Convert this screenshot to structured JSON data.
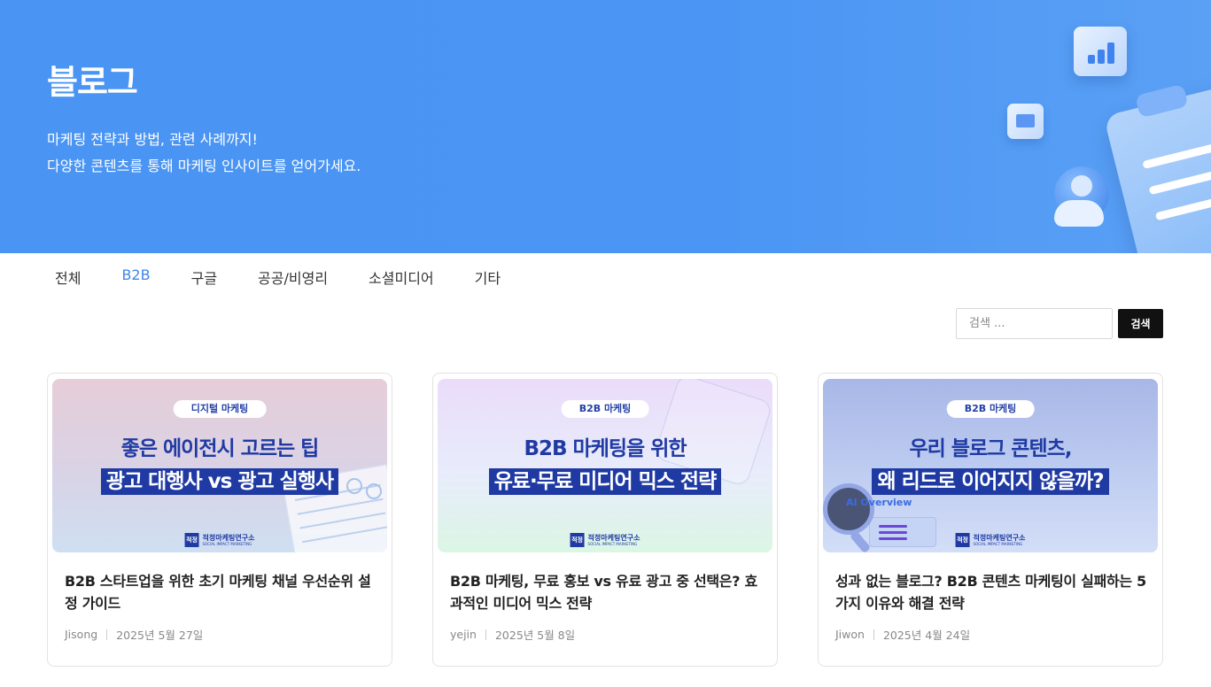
{
  "hero": {
    "title": "블로그",
    "desc_line1": "마케팅 전략과 방법, 관련 사례까지!",
    "desc_line2": "다양한 콘텐츠를 통해 마케팅 인사이트를 얻어가세요."
  },
  "tabs": [
    {
      "label": "전체",
      "active": false
    },
    {
      "label": "B2B",
      "active": true
    },
    {
      "label": "구글",
      "active": false
    },
    {
      "label": "공공/비영리",
      "active": false
    },
    {
      "label": "소셜미디어",
      "active": false
    },
    {
      "label": "기타",
      "active": false
    }
  ],
  "search": {
    "placeholder": "검색 ...",
    "button_label": "검색"
  },
  "brand": {
    "name": "적정마케팅연구소",
    "sub": "SOCIAL IMPACT MARKETING",
    "logo": "적정"
  },
  "posts": [
    {
      "thumb_tag": "디지털 마케팅",
      "thumb_line1": "좋은 에이전시 고르는 팁",
      "thumb_line2": "광고 대행사 vs 광고 실행사",
      "title": "B2B 스타트업을 위한 초기 마케팅 채널 우선순위 설정 가이드",
      "author": "Jisong",
      "date": "2025년 5월 27일"
    },
    {
      "thumb_tag": "B2B 마케팅",
      "thumb_line1": "B2B 마케팅을 위한",
      "thumb_line2": "유료·무료 미디어 믹스 전략",
      "title": "B2B 마케팅, 무료 홍보 vs 유료 광고 중 선택은? 효과적인 미디어 믹스 전략",
      "author": "yejin",
      "date": "2025년 5월 8일"
    },
    {
      "thumb_tag": "B2B 마케팅",
      "thumb_line1": "우리 블로그 콘텐츠,",
      "thumb_line2": "왜 리드로 이어지지 않을까?",
      "thumb_ai": "AI Overview",
      "title": "성과 없는 블로그? B2B 콘텐츠 마케팅이 실패하는 5가지 이유와 해결 전략",
      "author": "Jiwon",
      "date": "2025년 4월 24일"
    }
  ],
  "colors": {
    "hero_bg": "#4a94f3",
    "active_tab": "#3f86e8",
    "accent_navy": "#1f3aa3",
    "search_button": "#111111"
  }
}
